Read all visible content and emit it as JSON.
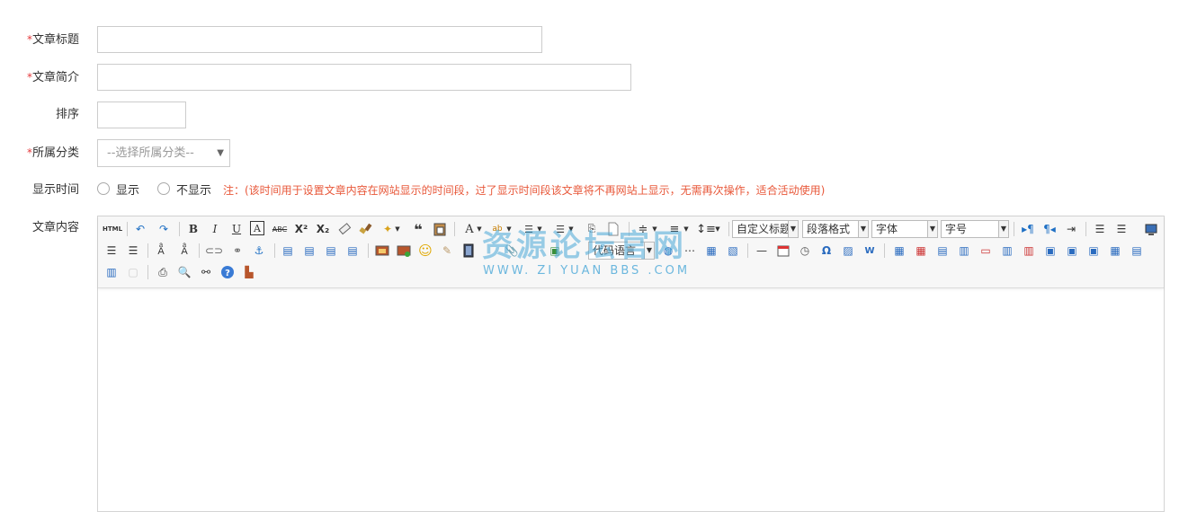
{
  "form": {
    "title_label": "文章标题",
    "summary_label": "文章简介",
    "sort_label": "排序",
    "category_label": "所属分类",
    "category_placeholder": "--选择所属分类--",
    "display_time_label": "显示时间",
    "radio_show": "显示",
    "radio_hide": "不显示",
    "note": "注：(该时间用于设置文章内容在网站显示的时间段，过了显示时间段该文章将不再网站上显示，无需再次操作，适合活动使用)",
    "content_label": "文章内容",
    "required_mark": "*"
  },
  "editor": {
    "html_label": "HTML",
    "combo_custom_title": "自定义标题",
    "combo_paragraph": "段落格式",
    "combo_font": "字体",
    "combo_size": "字号",
    "combo_lang": "代码语言"
  },
  "watermark": {
    "main": "资源论坛官网",
    "sub": "WWW. ZI YUAN BBS .COM"
  },
  "colors": {
    "required": "#e4393c",
    "note": "#e8583a",
    "toolbar_bg": "#f7f7f7"
  }
}
